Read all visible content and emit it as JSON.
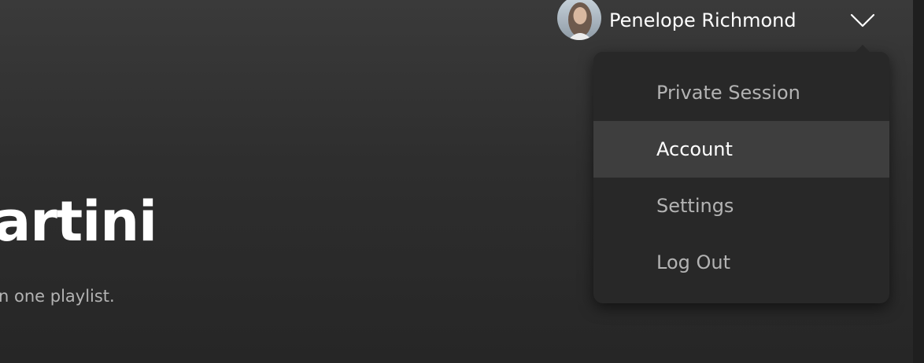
{
  "hero": {
    "title_fragment": "artini",
    "description_fragment": "n one playlist."
  },
  "user": {
    "name": "Penelope Richmond",
    "avatar_icon": "user-avatar-photo",
    "dropdown_icon": "chevron-down-icon"
  },
  "menu": {
    "items": [
      {
        "label": "Private Session",
        "active": false
      },
      {
        "label": "Account",
        "active": true
      },
      {
        "label": "Settings",
        "active": false
      },
      {
        "label": "Log Out",
        "active": false
      }
    ]
  },
  "colors": {
    "background_top": "#3a3a3a",
    "background_bottom": "#262626",
    "menu_background": "#282828",
    "menu_highlight": "#3e3e3e",
    "text_primary": "#ffffff",
    "text_secondary": "#b3b3b3"
  }
}
